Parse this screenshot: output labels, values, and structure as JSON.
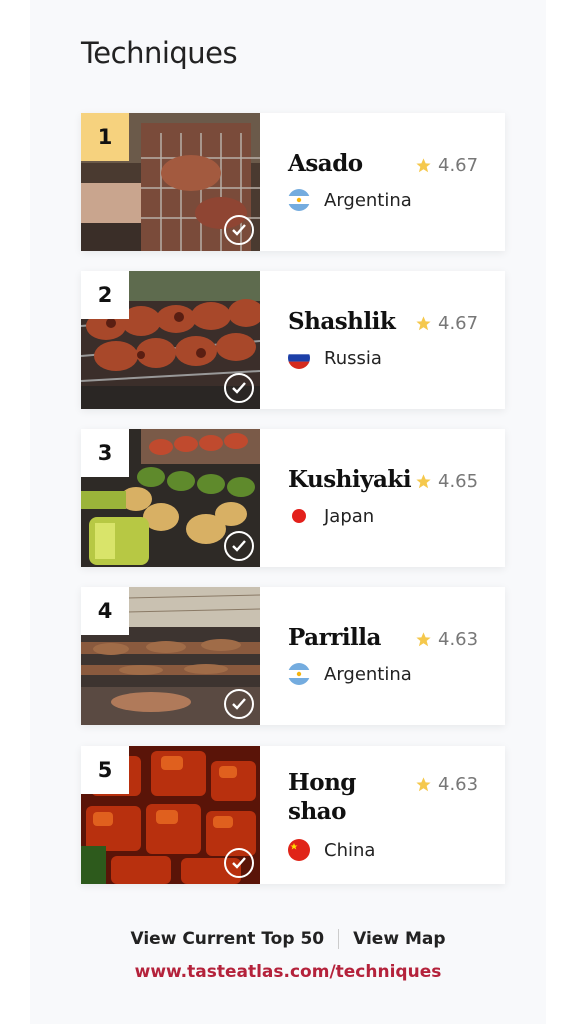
{
  "page": {
    "title": "Techniques"
  },
  "items": [
    {
      "rank": "1",
      "name": "Asado",
      "rating": "4.67",
      "country": "Argentina",
      "flag": "argentina-flag-icon"
    },
    {
      "rank": "2",
      "name": "Shashlik",
      "rating": "4.67",
      "country": "Russia",
      "flag": "russia-flag-icon"
    },
    {
      "rank": "3",
      "name": "Kushiyaki",
      "rating": "4.65",
      "country": "Japan",
      "flag": "japan-flag-icon"
    },
    {
      "rank": "4",
      "name": "Parrilla",
      "rating": "4.63",
      "country": "Argentina",
      "flag": "argentina-flag-icon"
    },
    {
      "rank": "5",
      "name": "Hong shao",
      "rating": "4.63",
      "country": "China",
      "flag": "china-flag-icon"
    }
  ],
  "footer": {
    "link_top50": "View Current Top 50",
    "link_map": "View Map",
    "url": "www.tasteatlas.com/techniques"
  },
  "colors": {
    "rank_one_badge": "#f6d27e",
    "star": "#f5c84c",
    "url": "#b4223b"
  }
}
